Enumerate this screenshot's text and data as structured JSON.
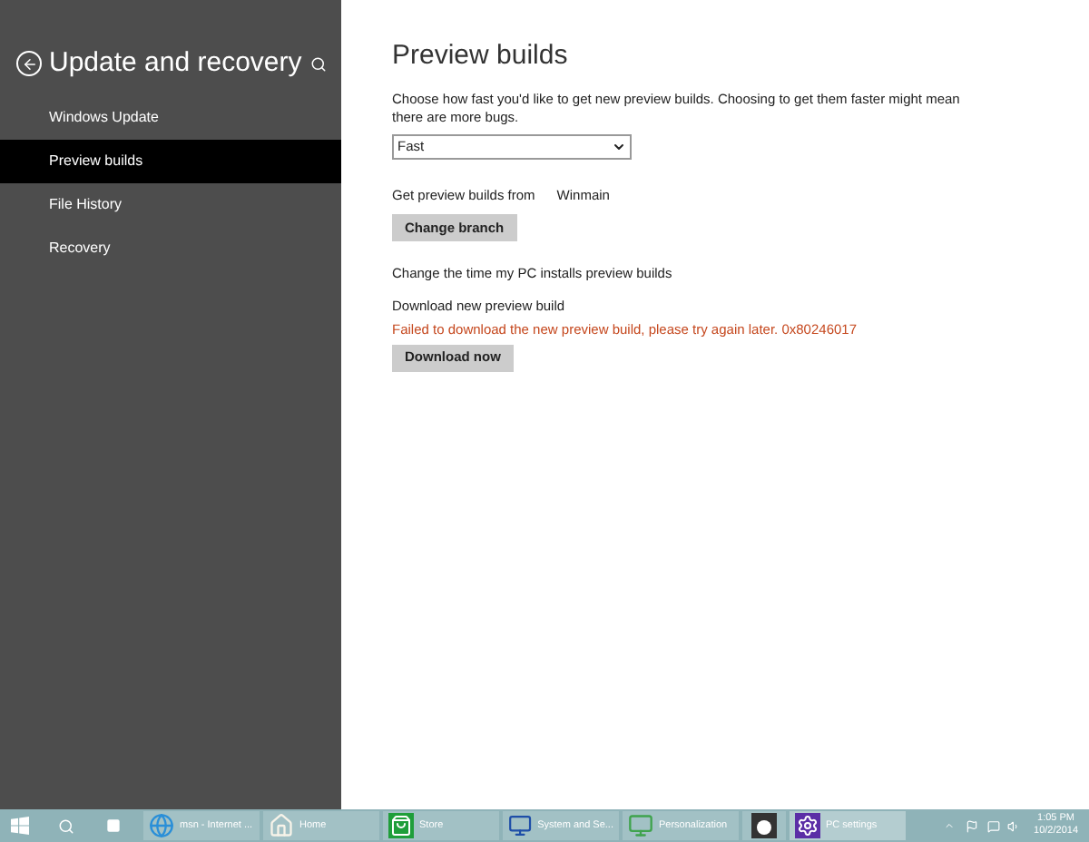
{
  "sidebar": {
    "title": "Update and recovery",
    "items": [
      {
        "label": "Windows Update",
        "selected": false
      },
      {
        "label": "Preview builds",
        "selected": true
      },
      {
        "label": "File History",
        "selected": false
      },
      {
        "label": "Recovery",
        "selected": false
      }
    ]
  },
  "main": {
    "title": "Preview builds",
    "description": "Choose how fast you'd like to get new preview builds. Choosing to get them faster might mean there are more bugs.",
    "speed_dropdown": {
      "value": "Fast"
    },
    "source_label": "Get preview builds from",
    "source_value": "Winmain",
    "change_branch_button": "Change branch",
    "install_time_link": "Change the time my PC installs preview builds",
    "download_label": "Download new preview build",
    "error": "Failed to download the new preview build, please try again later. 0x80246017",
    "download_button": "Download now"
  },
  "taskbar": {
    "items": [
      {
        "kind": "ie",
        "label": "msn - Internet ...",
        "selected": false
      },
      {
        "kind": "home",
        "label": "Home",
        "selected": false
      },
      {
        "kind": "store",
        "label": "Store",
        "selected": false
      },
      {
        "kind": "system",
        "label": "System and Se...",
        "selected": false
      },
      {
        "kind": "personalization",
        "label": "Personalization",
        "selected": false
      },
      {
        "kind": "app",
        "selected": false
      },
      {
        "kind": "settings",
        "label": "PC settings",
        "selected": true
      }
    ],
    "time": "1:05 PM",
    "date": "10/2/2014"
  }
}
